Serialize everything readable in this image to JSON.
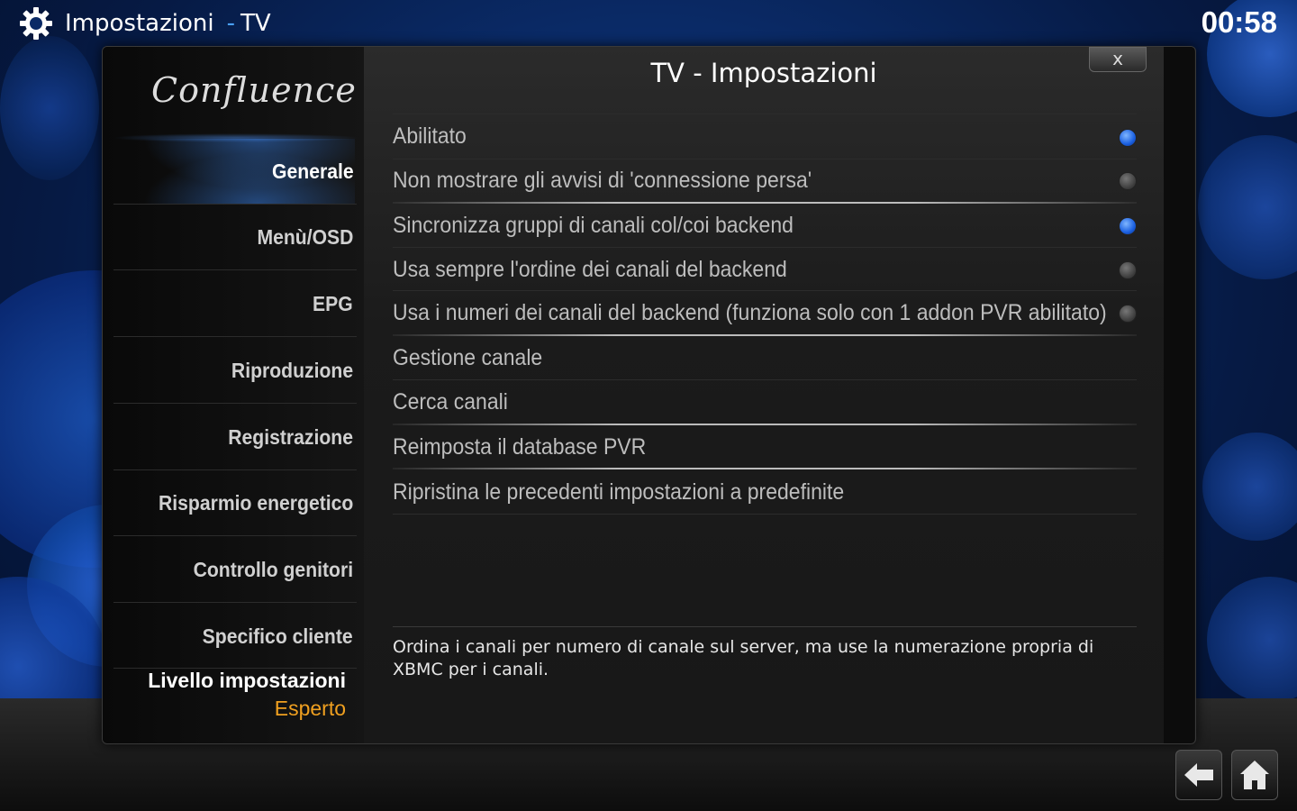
{
  "topbar": {
    "section": "Impostazioni",
    "separator": "-",
    "subsection": "TV",
    "clock": "00:58"
  },
  "logo": "Confluence",
  "dialog": {
    "heading": "TV - Impostazioni",
    "close_label": "x"
  },
  "categories": [
    {
      "label": "Generale",
      "active": true
    },
    {
      "label": "Menù/OSD"
    },
    {
      "label": "EPG"
    },
    {
      "label": "Riproduzione"
    },
    {
      "label": "Registrazione"
    },
    {
      "label": "Risparmio energetico"
    },
    {
      "label": "Controllo genitori"
    },
    {
      "label": "Specifico cliente"
    }
  ],
  "settings_level": {
    "label": "Livello impostazioni",
    "value": "Esperto"
  },
  "settings": [
    {
      "label": "Abilitato",
      "toggle": true
    },
    {
      "label": "Non mostrare gli avvisi  di 'connessione persa'",
      "toggle": false
    },
    {
      "label": "Sincronizza gruppi di canali col/coi backend",
      "toggle": true
    },
    {
      "label": "Usa sempre l'ordine dei canali del backend",
      "toggle": false
    },
    {
      "label": "Usa i numeri dei canali del backend (funziona solo con 1 addon PVR abilitato)",
      "toggle": false
    },
    {
      "label": "Gestione canale"
    },
    {
      "label": "Cerca canali"
    },
    {
      "label": "Reimposta il database PVR"
    },
    {
      "label": "Ripristina le precedenti impostazioni a predefinite"
    }
  ],
  "description": "Ordina i canali per numero di canale sul server, ma use la numerazione propria di XBMC per i canali.",
  "colors": {
    "accent": "#1a5fe0",
    "level_value": "#f0a020"
  },
  "icons": {
    "settings": "gear-icon",
    "back": "back-arrow-icon",
    "home": "home-icon"
  }
}
